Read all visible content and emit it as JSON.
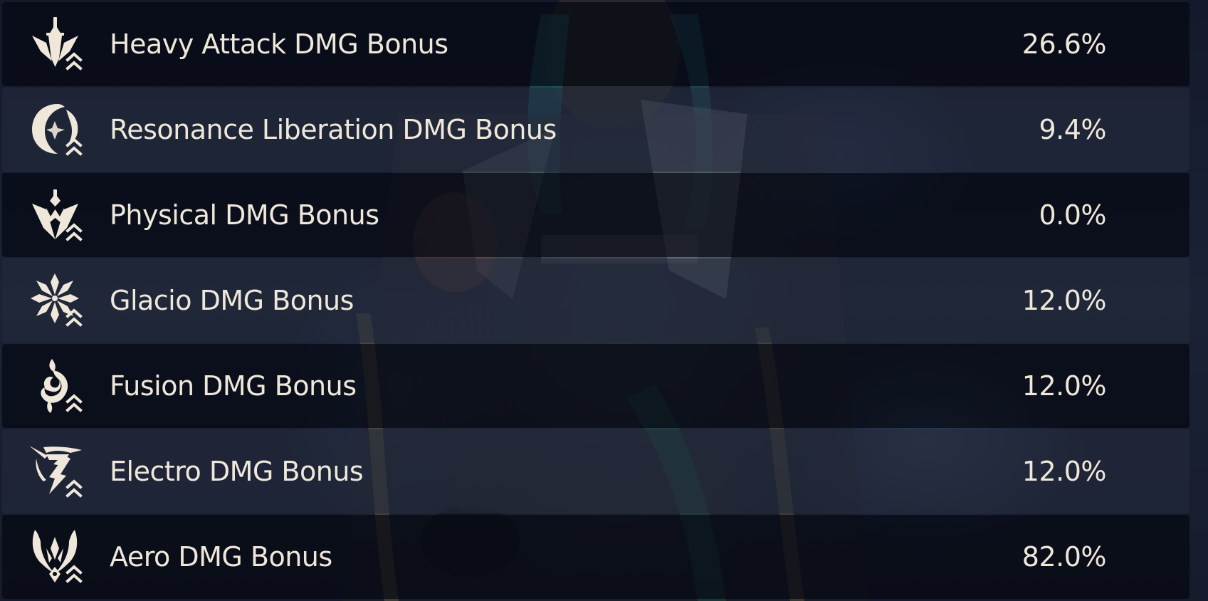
{
  "stats": [
    {
      "icon": "heavy-attack-icon",
      "label": "Heavy Attack DMG Bonus",
      "value": "26.6%"
    },
    {
      "icon": "resonance-liberation-icon",
      "label": "Resonance Liberation DMG Bonus",
      "value": "9.4%"
    },
    {
      "icon": "physical-icon",
      "label": "Physical DMG Bonus",
      "value": "0.0%"
    },
    {
      "icon": "glacio-icon",
      "label": "Glacio DMG Bonus",
      "value": "12.0%"
    },
    {
      "icon": "fusion-icon",
      "label": "Fusion DMG Bonus",
      "value": "12.0%"
    },
    {
      "icon": "electro-icon",
      "label": "Electro DMG Bonus",
      "value": "12.0%"
    },
    {
      "icon": "aero-icon",
      "label": "Aero DMG Bonus",
      "value": "82.0%"
    }
  ],
  "colors": {
    "text": "#efe8da",
    "row_dark": "#06091299",
    "row_light": "#242a3c9e"
  }
}
